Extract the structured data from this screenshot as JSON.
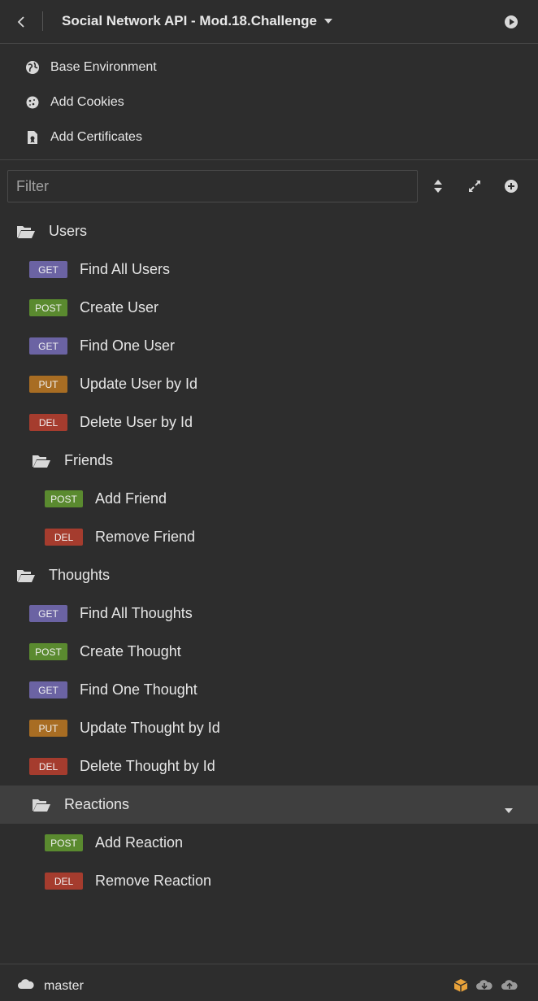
{
  "header": {
    "title": "Social Network API - Mod.18.Challenge"
  },
  "env_menu": [
    {
      "label": "Base Environment",
      "icon": "globe-icon"
    },
    {
      "label": "Add Cookies",
      "icon": "cookie-icon"
    },
    {
      "label": "Add Certificates",
      "icon": "certificate-icon"
    }
  ],
  "filter": {
    "placeholder": "Filter",
    "value": ""
  },
  "colors": {
    "get": "#6b63a3",
    "post": "#5a8a2f",
    "put": "#a86d23",
    "del": "#a53c2e"
  },
  "tree": {
    "users": {
      "label": "Users",
      "requests": [
        {
          "method": "GET",
          "label": "Find All Users"
        },
        {
          "method": "POST",
          "label": "Create User"
        },
        {
          "method": "GET",
          "label": "Find One User"
        },
        {
          "method": "PUT",
          "label": "Update User by Id"
        },
        {
          "method": "DEL",
          "label": "Delete User by Id"
        }
      ],
      "friends": {
        "label": "Friends",
        "requests": [
          {
            "method": "POST",
            "label": "Add Friend"
          },
          {
            "method": "DEL",
            "label": "Remove Friend"
          }
        ]
      }
    },
    "thoughts": {
      "label": "Thoughts",
      "requests": [
        {
          "method": "GET",
          "label": "Find All Thoughts"
        },
        {
          "method": "POST",
          "label": "Create Thought"
        },
        {
          "method": "GET",
          "label": "Find One Thought"
        },
        {
          "method": "PUT",
          "label": "Update Thought by Id"
        },
        {
          "method": "DEL",
          "label": "Delete Thought by Id"
        }
      ],
      "reactions": {
        "label": "Reactions",
        "requests": [
          {
            "method": "POST",
            "label": "Add Reaction"
          },
          {
            "method": "DEL",
            "label": "Remove Reaction"
          }
        ]
      }
    }
  },
  "footer": {
    "branch": "master"
  }
}
